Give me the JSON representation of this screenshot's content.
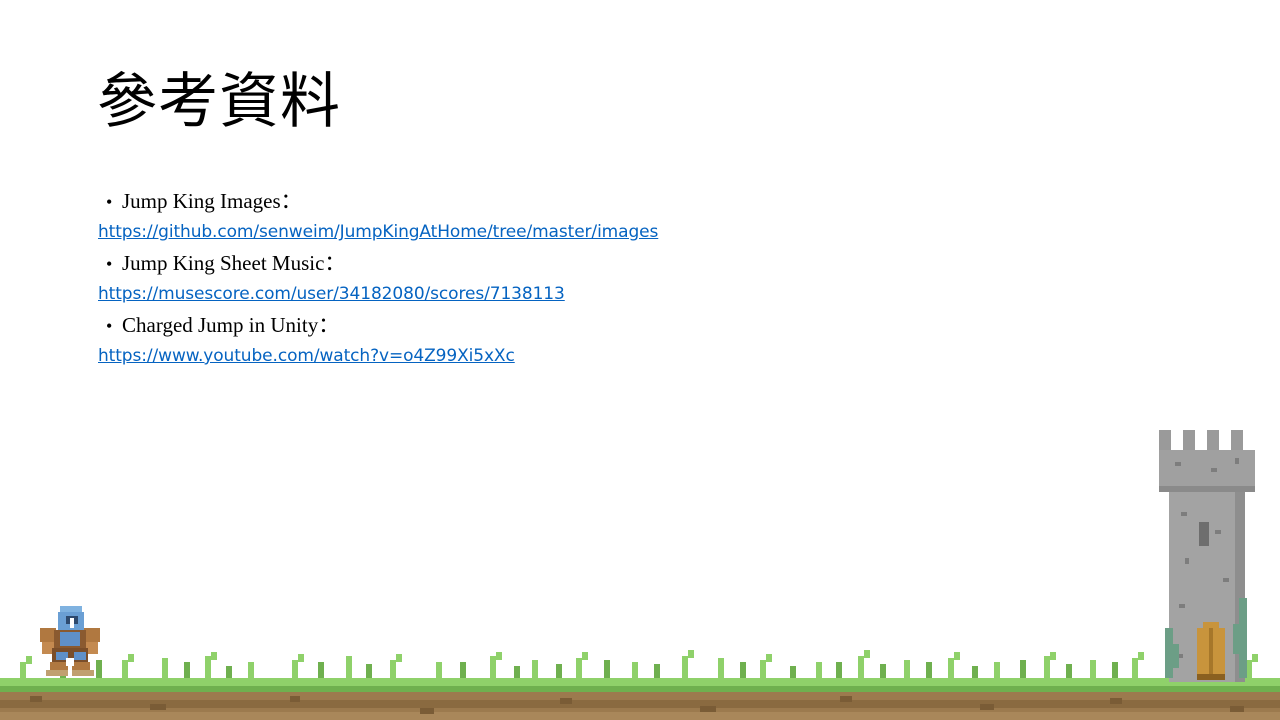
{
  "slide": {
    "title": "參考資料",
    "references": [
      {
        "bullet": "•",
        "label": "Jump King Images：",
        "url": "https://github.com/senweim/JumpKingAtHome/tree/master/images"
      },
      {
        "bullet": "•",
        "label": "Jump King Sheet Music：",
        "url": "https://musescore.com/user/34182080/scores/7138113"
      },
      {
        "bullet": "•",
        "label": "Charged Jump in Unity：",
        "url": "https://www.youtube.com/watch?v=o4Z99Xi5xXc"
      }
    ]
  },
  "colors": {
    "link": "#0563c1",
    "grass": "#7cc35a",
    "dirt": "#9c7a4e",
    "stone": "#9a9a9a",
    "door": "#c8943c"
  },
  "icons": [
    "knight-sprite-icon",
    "tower-illustration",
    "pixel-grass-ground"
  ]
}
